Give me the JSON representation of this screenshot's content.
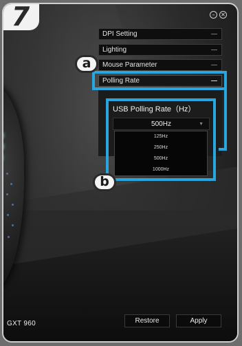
{
  "step_number": "7",
  "window_controls": {
    "minimize": "–",
    "close": "✕"
  },
  "menu": [
    {
      "label": "DPI Setting"
    },
    {
      "label": "Lighting"
    },
    {
      "label": "Mouse Parameter"
    },
    {
      "label": "Polling Rate"
    }
  ],
  "callouts": {
    "a": "a",
    "b": "b"
  },
  "polling": {
    "title": "USB Polling Rate（Hz）",
    "selected": "500Hz",
    "options": [
      "125Hz",
      "250Hz",
      "500Hz",
      "1000Hz"
    ]
  },
  "brand": "GXT 960",
  "buttons": {
    "restore": "Restore",
    "apply": "Apply"
  },
  "colors": {
    "highlight": "#2aa6df",
    "led": "#6de8d8"
  }
}
